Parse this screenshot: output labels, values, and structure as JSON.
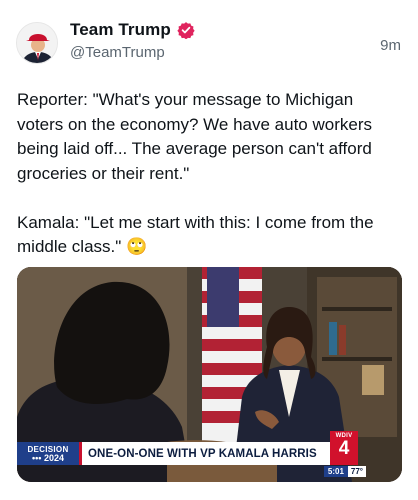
{
  "post": {
    "author": {
      "display_name": "Team Trump",
      "handle": "@TeamTrump",
      "verified_icon": "verified-badge-icon"
    },
    "timestamp": "9m",
    "text": "Reporter: \"What's your message to Michigan voters on the economy? We have auto workers being laid off... The average person can't afford groceries or their rent.\"\n\nKamala: \"Let me start with this: I come from the middle class.\" 🙄"
  },
  "media": {
    "lower_third": {
      "badge_line1": "DECISION",
      "badge_line2": "••• 2024",
      "headline": "ONE-ON-ONE WITH VP KAMALA HARRIS"
    },
    "station": {
      "call_sign": "WDIV",
      "channel": "4"
    },
    "clock": {
      "time": "5:01",
      "temperature": "77°"
    }
  },
  "colors": {
    "verified": "#e0245e",
    "decision_blue": "#1f3f8a",
    "station_red": "#d1112c"
  }
}
